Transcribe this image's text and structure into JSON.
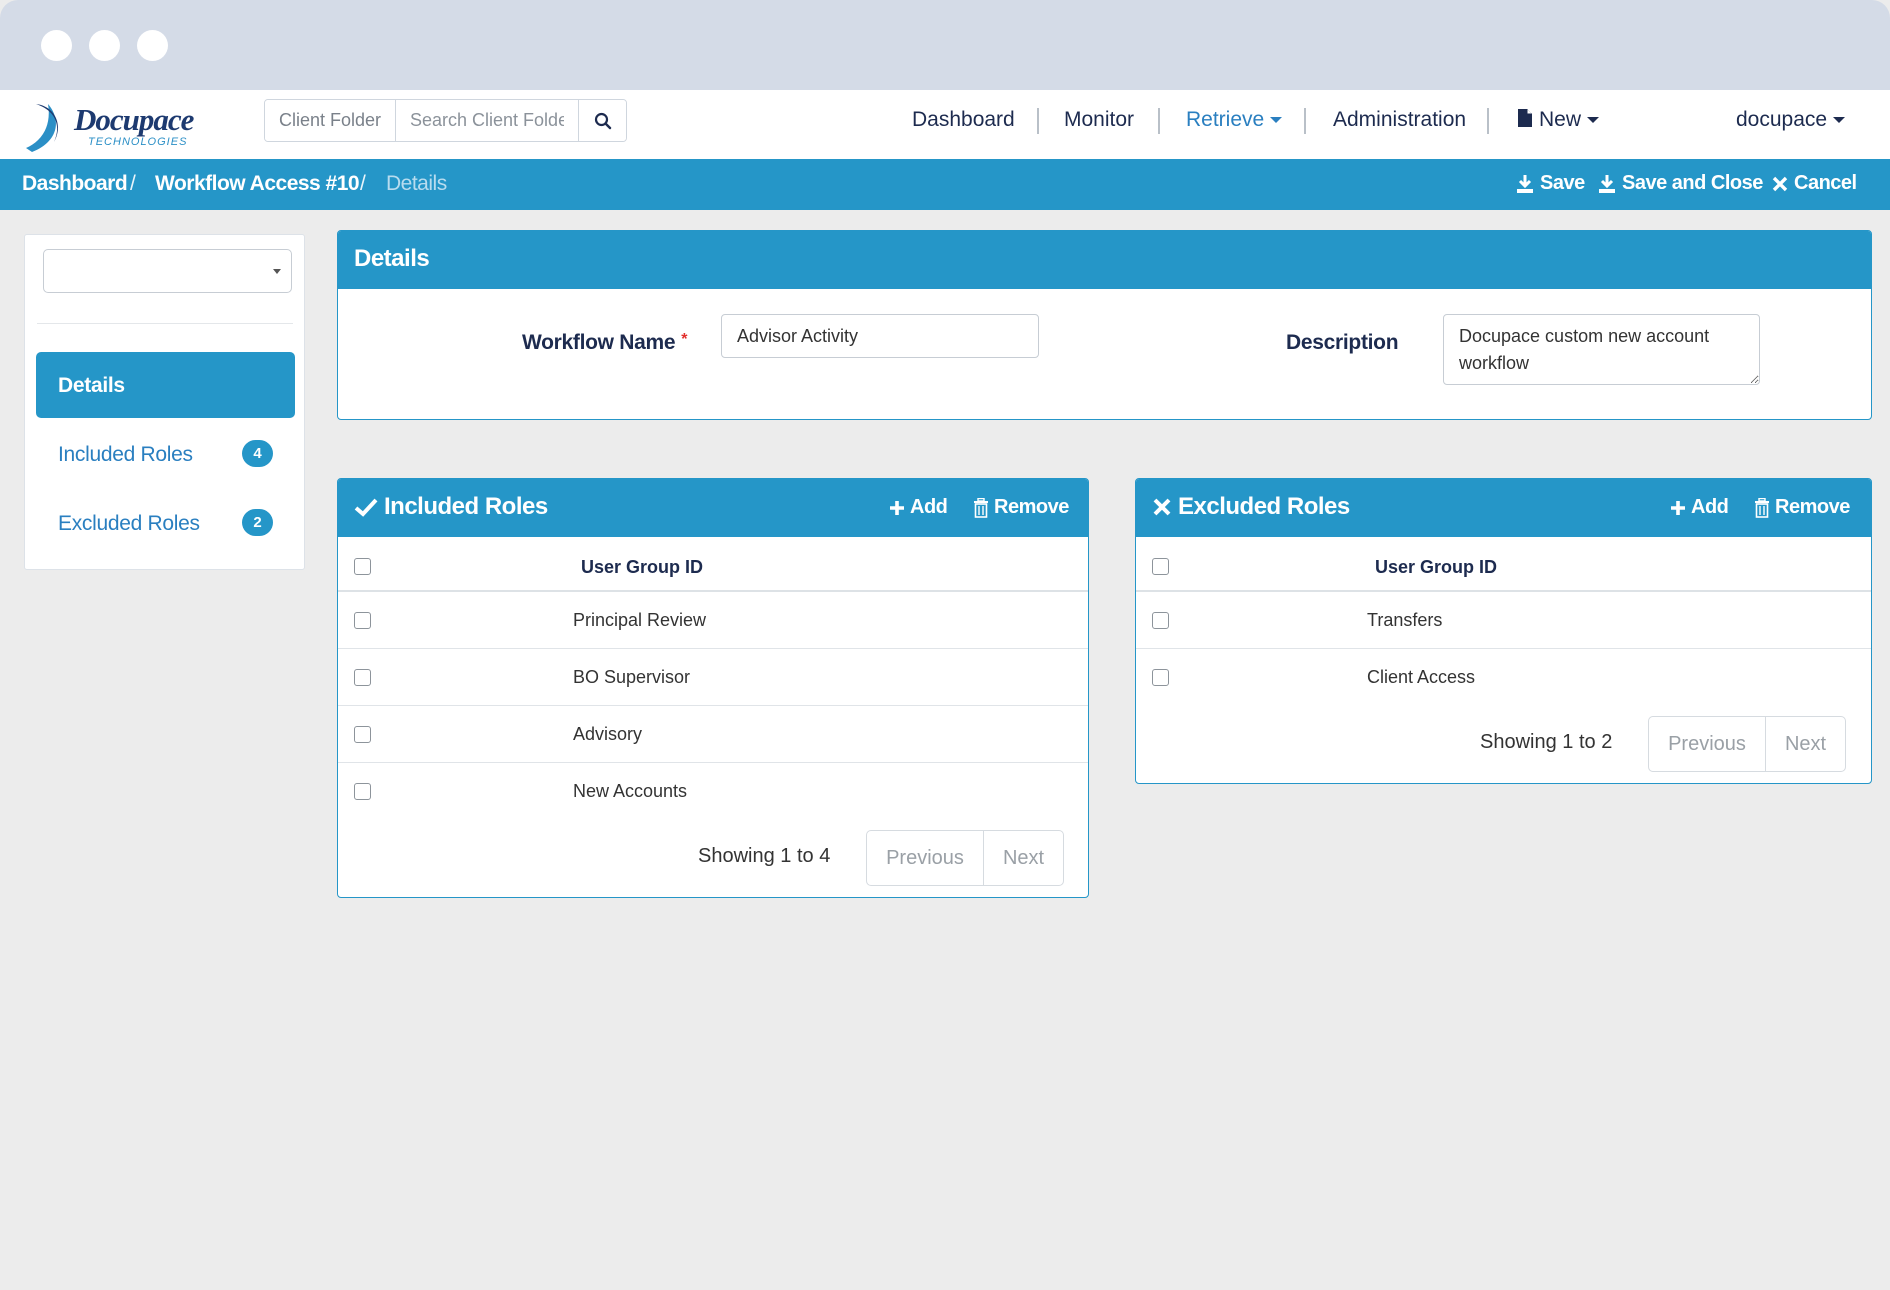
{
  "window": {
    "dots": [
      "",
      "",
      ""
    ]
  },
  "brand": {
    "name": "Docupace",
    "tagline": "TECHNOLOGIES"
  },
  "search": {
    "addon": "Client Folder",
    "placeholder": "Search Client Folder"
  },
  "nav": {
    "dashboard": "Dashboard",
    "monitor": "Monitor",
    "retrieve": "Retrieve",
    "administration": "Administration",
    "new": "New",
    "user": "docupace",
    "active_color": "#2a7fc0"
  },
  "breadcrumb": {
    "items": [
      "Dashboard",
      "Workflow Access #10",
      "Details"
    ],
    "separator": "/"
  },
  "actions": {
    "save": "Save",
    "save_close": "Save and Close",
    "cancel": "Cancel"
  },
  "sidebar": {
    "select_value": "",
    "items": [
      {
        "label": "Details",
        "active": true
      },
      {
        "label": "Included Roles",
        "badge": "4"
      },
      {
        "label": "Excluded Roles",
        "badge": "2"
      }
    ]
  },
  "details": {
    "title": "Details",
    "workflow_name_label": "Workflow Name",
    "required_mark": "*",
    "workflow_name_value": "Advisor Activity",
    "description_label": "Description",
    "description_value": "Docupace custom new account workflow"
  },
  "included": {
    "title": "Included Roles",
    "add": "Add",
    "remove": "Remove",
    "column": "User Group ID",
    "rows": [
      "Principal Review",
      "BO Supervisor",
      "Advisory",
      "New Accounts"
    ],
    "showing": "Showing 1 to 4",
    "prev": "Previous",
    "next": "Next"
  },
  "excluded": {
    "title": "Excluded Roles",
    "add": "Add",
    "remove": "Remove",
    "column": "User Group ID",
    "rows": [
      "Transfers",
      "Client Access"
    ],
    "showing": "Showing 1 to 2",
    "prev": "Previous",
    "next": "Next"
  },
  "colors": {
    "primary": "#2596c8",
    "navy": "#1d2b4f",
    "background": "#ececec"
  }
}
